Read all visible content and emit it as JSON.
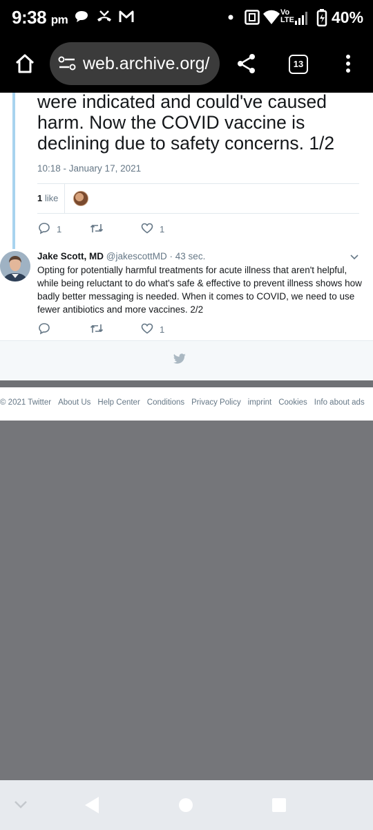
{
  "status_bar": {
    "time": "9:38",
    "ampm": "pm",
    "volte": "Vo",
    "lte": "LTE",
    "battery": "40%"
  },
  "browser": {
    "url": "web.archive.org/",
    "tab_count": "13"
  },
  "tweet": {
    "text": "were indicated and could've caused harm. Now the COVID vaccine is declining due to safety concerns. 1/2",
    "timestamp": "10:18 - January 17, 2021",
    "likes_count": "1",
    "likes_label": "like",
    "reply_count": "1",
    "like_count": "1"
  },
  "reply": {
    "author": "Jake Scott, MD",
    "handle": "@jakescottMD",
    "time": "· 43 sec.",
    "text": "Opting for potentially harmful treatments for acute illness that aren't helpful, while being reluctant to do what's safe & effective to prevent illness shows how badly better messaging is needed. When it comes to COVID, we need to use fewer antibiotics and more vaccines. 2/2",
    "like_count": "1"
  },
  "footer": {
    "links": [
      "© 2021 Twitter",
      "About Us",
      "Help Center",
      "Conditions",
      "Privacy Policy",
      "imprint",
      "Cookies",
      "Info about ads"
    ]
  },
  "colors": {
    "twitter_secondary": "#657786",
    "thread_line": "#a8d3ef",
    "page_background": "#75767a"
  }
}
